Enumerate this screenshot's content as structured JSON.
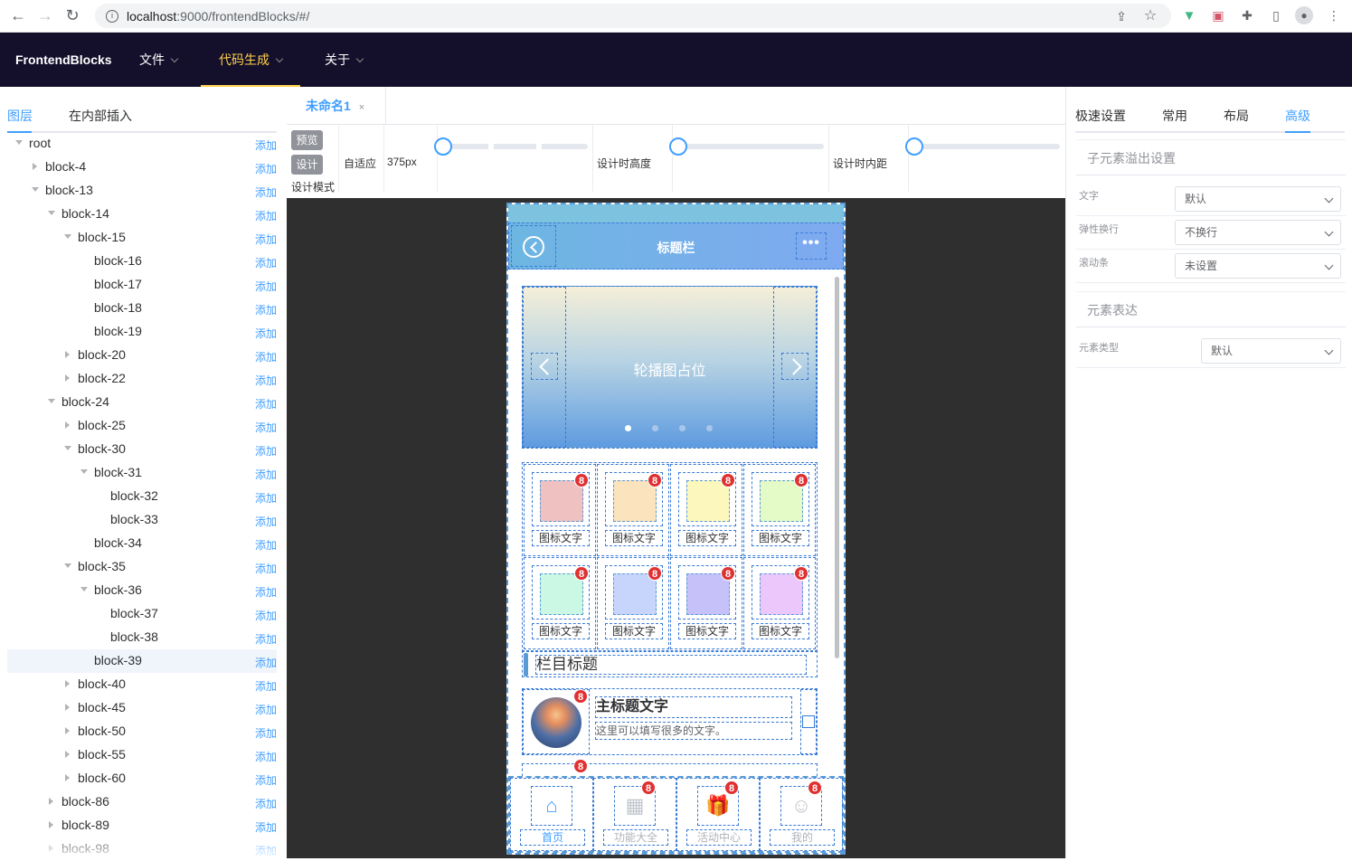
{
  "browser": {
    "url_host": "localhost",
    "url_path": ":9000/frontendBlocks/#/"
  },
  "app": {
    "brand": "FrontendBlocks",
    "menus": [
      {
        "label": "文件",
        "active": false
      },
      {
        "label": "代码生成",
        "active": true
      },
      {
        "label": "关于",
        "active": false
      }
    ],
    "accent": "#409eff",
    "header_bg": "#140f2b",
    "menu_active_color": "#ffd04b"
  },
  "left_panel": {
    "tabs": [
      "图层",
      "在内部插入"
    ],
    "add_label": "添加",
    "tree": [
      {
        "label": "root",
        "level": 0,
        "toggle": "expanded"
      },
      {
        "label": "block-4",
        "level": 1,
        "toggle": "collapsed"
      },
      {
        "label": "block-13",
        "level": 1,
        "toggle": "expanded"
      },
      {
        "label": "block-14",
        "level": 2,
        "toggle": "expanded"
      },
      {
        "label": "block-15",
        "level": 3,
        "toggle": "expanded"
      },
      {
        "label": "block-16",
        "level": 4,
        "toggle": "none"
      },
      {
        "label": "block-17",
        "level": 4,
        "toggle": "none"
      },
      {
        "label": "block-18",
        "level": 4,
        "toggle": "none"
      },
      {
        "label": "block-19",
        "level": 4,
        "toggle": "none"
      },
      {
        "label": "block-20",
        "level": 3,
        "toggle": "collapsed"
      },
      {
        "label": "block-22",
        "level": 3,
        "toggle": "collapsed"
      },
      {
        "label": "block-24",
        "level": 2,
        "toggle": "expanded"
      },
      {
        "label": "block-25",
        "level": 3,
        "toggle": "collapsed"
      },
      {
        "label": "block-30",
        "level": 3,
        "toggle": "expanded"
      },
      {
        "label": "block-31",
        "level": 4,
        "toggle": "expanded"
      },
      {
        "label": "block-32",
        "level": 5,
        "toggle": "none"
      },
      {
        "label": "block-33",
        "level": 5,
        "toggle": "none"
      },
      {
        "label": "block-34",
        "level": 4,
        "toggle": "none"
      },
      {
        "label": "block-35",
        "level": 3,
        "toggle": "expanded"
      },
      {
        "label": "block-36",
        "level": 4,
        "toggle": "expanded"
      },
      {
        "label": "block-37",
        "level": 5,
        "toggle": "none"
      },
      {
        "label": "block-38",
        "level": 5,
        "toggle": "none"
      },
      {
        "label": "block-39",
        "level": 4,
        "toggle": "none",
        "selected": true
      },
      {
        "label": "block-40",
        "level": 3,
        "toggle": "collapsed"
      },
      {
        "label": "block-45",
        "level": 3,
        "toggle": "collapsed"
      },
      {
        "label": "block-50",
        "level": 3,
        "toggle": "collapsed"
      },
      {
        "label": "block-55",
        "level": 3,
        "toggle": "collapsed"
      },
      {
        "label": "block-60",
        "level": 3,
        "toggle": "collapsed"
      },
      {
        "label": "block-86",
        "level": 2,
        "toggle": "collapsed"
      },
      {
        "label": "block-89",
        "level": 2,
        "toggle": "collapsed"
      },
      {
        "label": "block-98",
        "level": 2,
        "toggle": "collapsed"
      }
    ]
  },
  "center": {
    "tab_label": "未命名1",
    "tab_close": "×",
    "preview_btn": "预览",
    "design_btn": "设计",
    "design_mode_label": "设计模式",
    "adapt_label": "自适应",
    "width_value": "375px",
    "design_height_label": "设计时高度",
    "design_padding_label": "设计时内距",
    "slider_width": 0,
    "slider_height": 0,
    "slider_padding": 0
  },
  "phone": {
    "title": "标题栏",
    "more_label": "•••",
    "carousel_text": "轮播图占位",
    "carousel_dot_count": 4,
    "carousel_active_dot": 0,
    "badge": "8",
    "icon_label": "图标文字",
    "icons": [
      {
        "color": "#f0c1c1"
      },
      {
        "color": "#fae3bd"
      },
      {
        "color": "#fcf8bd"
      },
      {
        "color": "#e4fbc8"
      },
      {
        "color": "#cbf8e4"
      },
      {
        "color": "#c7d4fc"
      },
      {
        "color": "#c7c1fa"
      },
      {
        "color": "#ecc7fc"
      }
    ],
    "section_title": "栏目标题",
    "list_item": {
      "title": "主标题文字",
      "subtitle": "这里可以填写很多的文字。"
    },
    "tabbar": [
      {
        "label": "首页",
        "icon": "home-icon",
        "active": true,
        "badge": false
      },
      {
        "label": "功能大全",
        "icon": "apps-icon",
        "active": false,
        "badge": true
      },
      {
        "label": "活动中心",
        "icon": "gift-icon",
        "active": false,
        "badge": true
      },
      {
        "label": "我的",
        "icon": "user-icon",
        "active": false,
        "badge": true
      }
    ]
  },
  "right_panel": {
    "tabs": [
      "极速设置",
      "常用",
      "布局",
      "高级"
    ],
    "active_tab": 3,
    "overflow_section": "子元素溢出设置",
    "rows": [
      {
        "key": "文字",
        "value": "默认"
      },
      {
        "key": "弹性换行",
        "value": "不换行"
      },
      {
        "key": "滚动条",
        "value": "未设置"
      }
    ],
    "expr_section": "元素表达",
    "element_type_key": "元素类型",
    "element_type_value": "默认"
  }
}
